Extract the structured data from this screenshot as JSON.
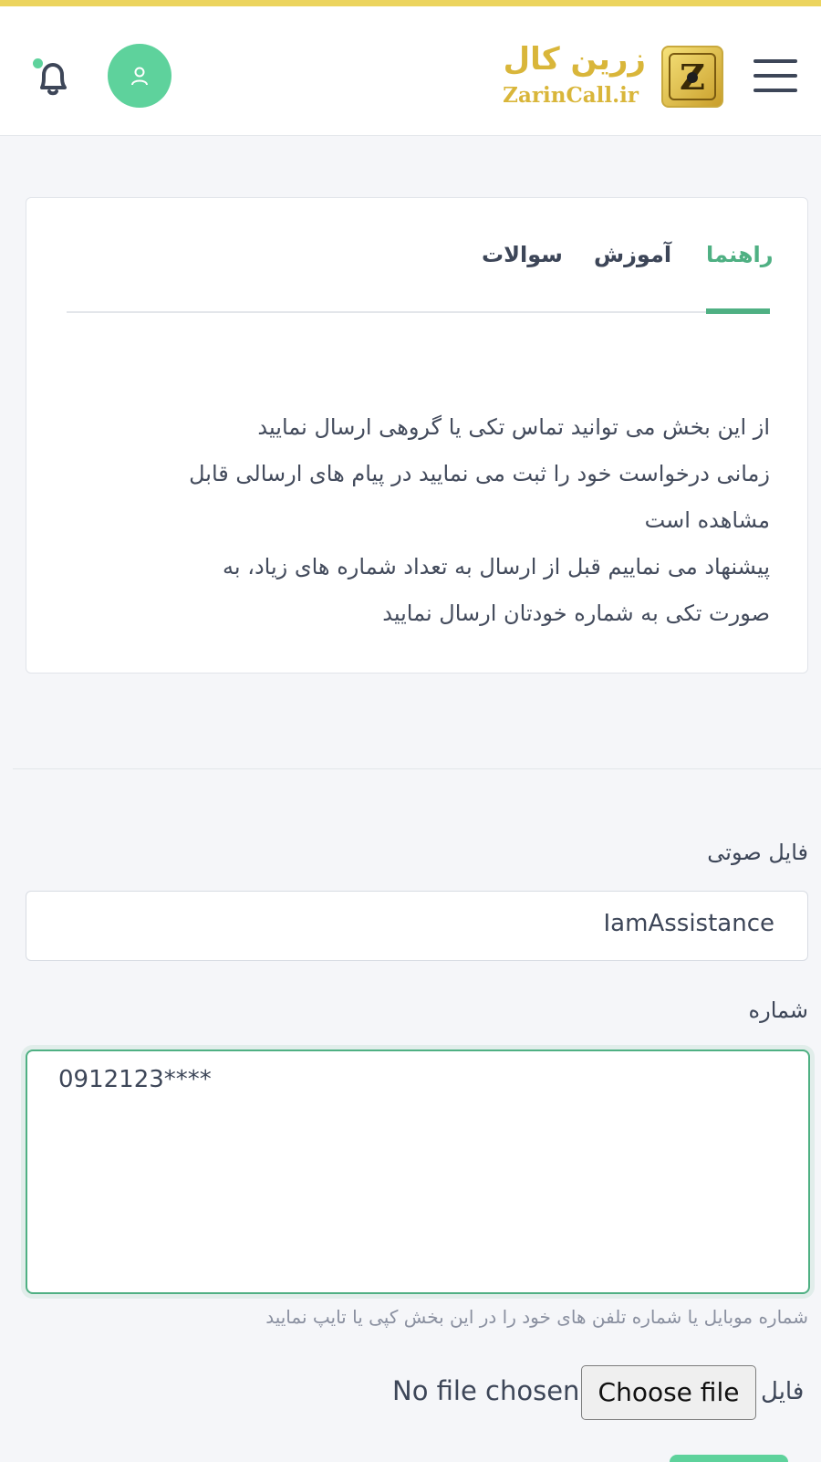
{
  "header": {
    "logo_text_fa": "زرین کال",
    "logo_text_en": "ZarinCall.ir",
    "logo_letter": "Z",
    "menu_icon": "hamburger-menu-icon",
    "avatar_icon": "user-icon",
    "bell_icon": "bell-icon",
    "accent_color": "#5ed29c",
    "brand_color": "#d9b63a"
  },
  "guide_card": {
    "tabs": [
      {
        "label": "راهنما",
        "active": true
      },
      {
        "label": "آموزش",
        "active": false
      },
      {
        "label": "سوالات",
        "active": false
      }
    ],
    "lines": [
      "از این بخش می توانید تماس تکی یا گروهی ارسال نمایید",
      "زمانی درخواست خود را ثبت می نمایید در پیام های ارسالی قابل",
      "مشاهده است",
      "پیشنهاد می نماییم قبل از ارسال به تعداد شماره های زیاد، به",
      "صورت تکی به شماره خودتان ارسال نمایید"
    ]
  },
  "form": {
    "audio_label": "فایل صوتی",
    "audio_value": "IamAssistance",
    "number_label": "شماره",
    "number_value": "0912123****",
    "number_help": "شماره موبایل یا شماره تلفن های خود را در این بخش کپی یا تایپ نمایید",
    "file_label": "فایل",
    "file_button": "Choose file",
    "file_status": "No file chosen"
  }
}
